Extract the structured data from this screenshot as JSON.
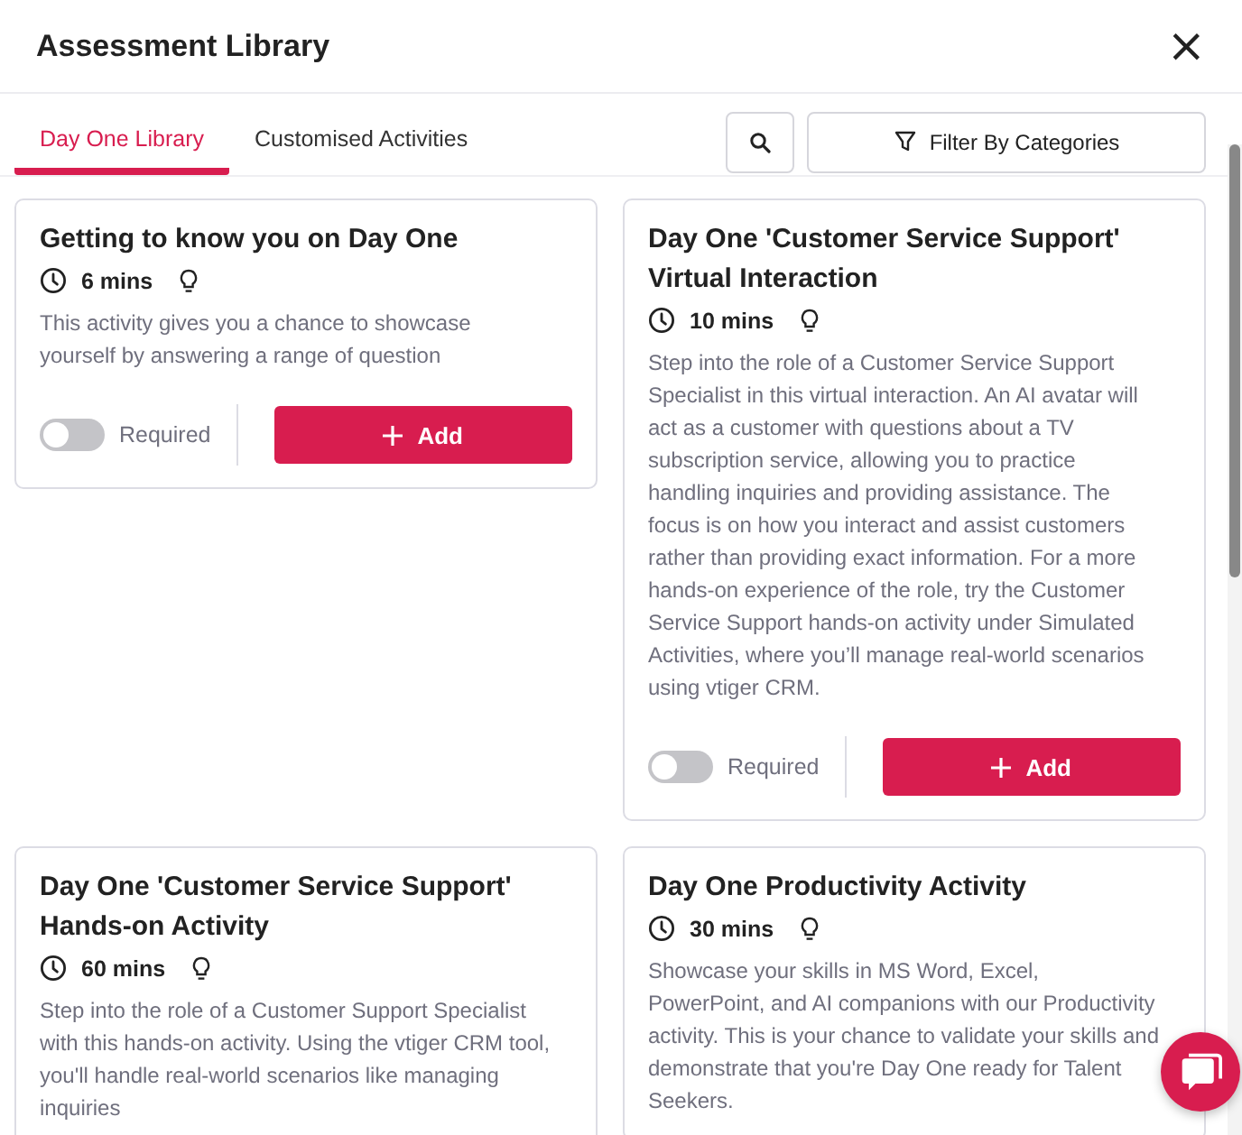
{
  "window": {
    "title": "Assessment Library",
    "close": "×"
  },
  "tabs": [
    {
      "label": "Day One Library",
      "selected": true
    },
    {
      "label": "Customised Activities",
      "selected": false
    }
  ],
  "filter_button": "Filter By Categories",
  "cards": [
    {
      "title": "Getting to know you on Day One",
      "duration": "6 mins",
      "description": "This activity gives you a chance to showcase yourself by answering a range of question",
      "required": false,
      "required_label": "Required",
      "add_label": "Add"
    },
    {
      "title": "Day One 'Customer Service Support' Virtual Interaction",
      "duration": "10 mins",
      "description": "Step into the role of a Customer Service Support Specialist in this virtual interaction. An AI avatar will act as a customer with questions about a TV subscription service, allowing you to practice handling inquiries and providing assistance. The focus is on how you interact and assist customers rather than providing exact information. For a more hands-on experience of the role, try the Customer Service Support hands-on activity under Simulated Activities, where you’ll manage real-world scenarios using vtiger CRM.",
      "required": false,
      "required_label": "Required",
      "add_label": "Add"
    },
    {
      "title": "Day One 'Customer Service Support' Hands-on Activity",
      "duration": "60 mins",
      "description": "Step into the role of a Customer Support Specialist with this hands-on activity. Using the vtiger CRM tool, you'll handle real-world scenarios like managing inquiries"
    },
    {
      "title": "Day One Productivity Activity",
      "duration": "30 mins",
      "description": "Showcase your skills in MS Word, Excel, PowerPoint, and AI companions with our Productivity activity. This is your chance to validate your skills and demonstrate that you're Day One ready for Talent Seekers."
    }
  ]
}
